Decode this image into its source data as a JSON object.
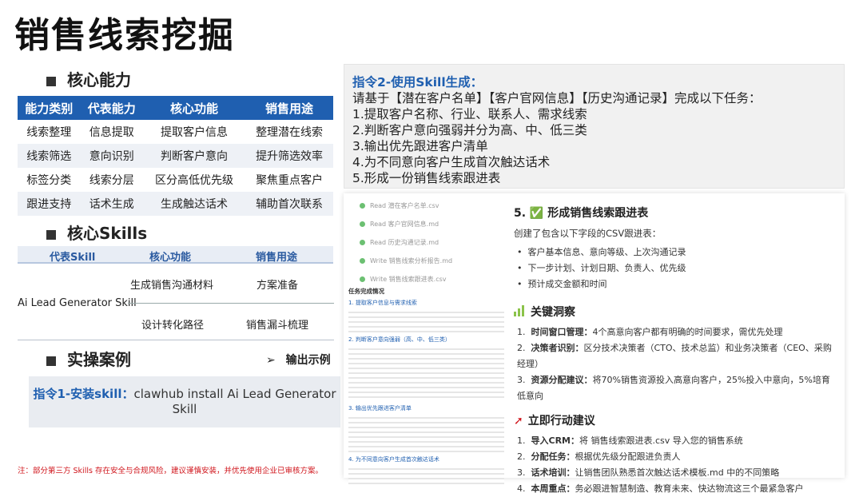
{
  "title": "销售线索挖掘",
  "core_ability": {
    "heading": "核心能力",
    "columns": [
      "能力类别",
      "代表能力",
      "核心功能",
      "销售用途"
    ],
    "rows": [
      [
        "线索整理",
        "信息提取",
        "提取客户信息",
        "整理潜在线索"
      ],
      [
        "线索筛选",
        "意向识别",
        "判断客户意向",
        "提升筛选效率"
      ],
      [
        "标签分类",
        "线索分层",
        "区分高低优先级",
        "聚焦重点客户"
      ],
      [
        "跟进支持",
        "话术生成",
        "生成触达话术",
        "辅助首次联系"
      ]
    ]
  },
  "core_skills": {
    "heading": "核心Skills",
    "columns": [
      "代表Skill",
      "核心功能",
      "销售用途"
    ],
    "skill_name": "Ai Lead Generator Skill",
    "func_1": "生成销售沟通材料",
    "use_1": "方案准备",
    "func_2": "设计转化路径",
    "use_2": "销售漏斗梳理"
  },
  "practice": {
    "heading": "实操案例",
    "output_example": "输出示例",
    "arrow": "➢",
    "cmd1_label": "指令1-安装skill：",
    "cmd1_text": "clawhub install Ai Lead Generator Skill"
  },
  "note": "注：部分第三方 Skills 存在安全与合规风险，建议谨慎安装，并优先使用企业已审核方案。",
  "cmd2": {
    "label": "指令2-使用Skill生成：",
    "intro": "请基于【潜在客户名单】【客户官网信息】【历史沟通记录】完成以下任务：",
    "tasks": [
      "1.提取客户名称、行业、联系人、需求线索",
      "2.判断客户意向强弱并分为高、中、低三类",
      "3.输出优先跟进客户清单",
      "4.为不同意向客户生成首次触达话术",
      "5.形成一份销售线索跟进表"
    ]
  },
  "screenshot": {
    "actions": [
      {
        "verb": "Read",
        "file": "潜在客户名单.csv"
      },
      {
        "verb": "Read",
        "file": "客户官网信息.md"
      },
      {
        "verb": "Read",
        "file": "历史沟通记录.md"
      },
      {
        "verb": "Write",
        "file": "销售线索分析报告.md"
      },
      {
        "verb": "Write",
        "file": "销售线索跟进表.csv"
      }
    ],
    "s5_title": "5. ✅ 形成销售线索跟进表",
    "s5_desc": "创建了包含以下字段的CSV跟进表：",
    "s5_items": [
      "客户基本信息、意向等级、上次沟通记录",
      "下一步计划、计划日期、负责人、优先级",
      "预计成交金额和时间"
    ],
    "insight_title": "关键洞察",
    "insights": [
      {
        "k": "时间窗口管理：",
        "v": "4个高意向客户都有明确的时间要求，需优先处理"
      },
      {
        "k": "决策者识别：",
        "v": "区分技术决策者（CTO、技术总监）和业务决策者（CEO、采购经理）"
      },
      {
        "k": "资源分配建议：",
        "v": "将70%销售资源投入高意向客户，25%投入中意向，5%培育低意向"
      }
    ],
    "action_title": "立即行动建议",
    "actions_list": [
      {
        "k": "导入CRM：",
        "v": "将 销售线索跟进表.csv 导入您的销售系统"
      },
      {
        "k": "分配任务：",
        "v": "根据优先级分配跟进负责人"
      },
      {
        "k": "话术培训：",
        "v": "让销售团队熟悉首次触达话术模板.md 中的不同策略"
      },
      {
        "k": "本周重点：",
        "v": "务必跟进智慧制造、教育未来、快达物流这三个最紧急客户"
      }
    ],
    "left_heading": "任务完成情况",
    "left_lines": [
      "1. 提取客户信息与需求线索",
      "2. 判断客户意向强弱（高、中、低三类）",
      "3. 输出优先跟进客户清单",
      "4. 为不同意向客户生成首次触达话术"
    ]
  },
  "colors": {
    "accent": "#1f5fb0",
    "note": "#d0141b"
  }
}
